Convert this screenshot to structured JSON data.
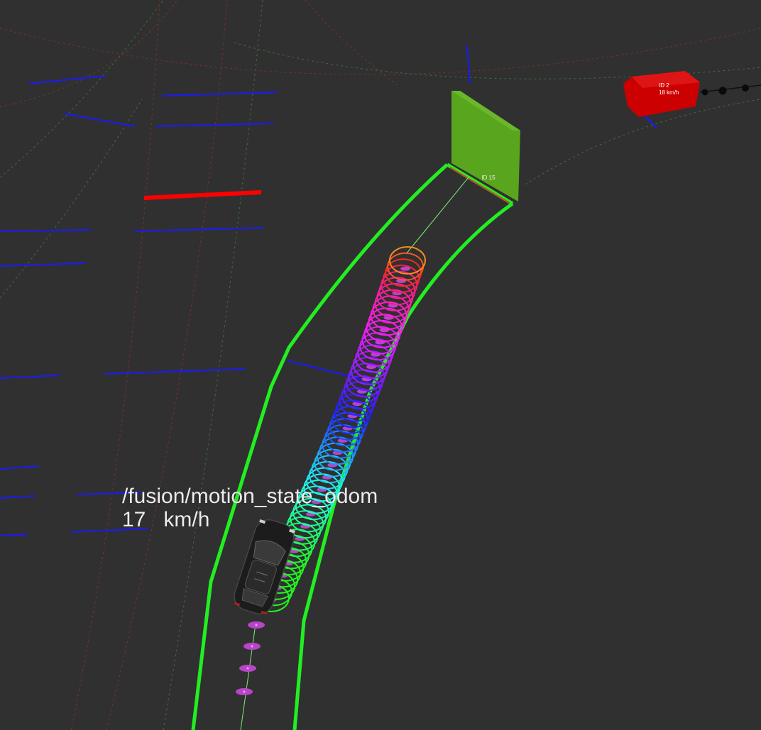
{
  "ego": {
    "topic": "/fusion/motion_state_odom",
    "speed": "17   km/h"
  },
  "obstacles": [
    {
      "id": "ID  15",
      "color": "#5aa51e"
    },
    {
      "id": "ID  2",
      "speed": "18  km/h",
      "color": "#cc0000"
    }
  ],
  "colors": {
    "background": "#303030",
    "lane_boundary": "#22ee22",
    "lane_marking": "#1a1aff",
    "stop_line": "#ff0000",
    "ego_trail": "#b845c8"
  }
}
